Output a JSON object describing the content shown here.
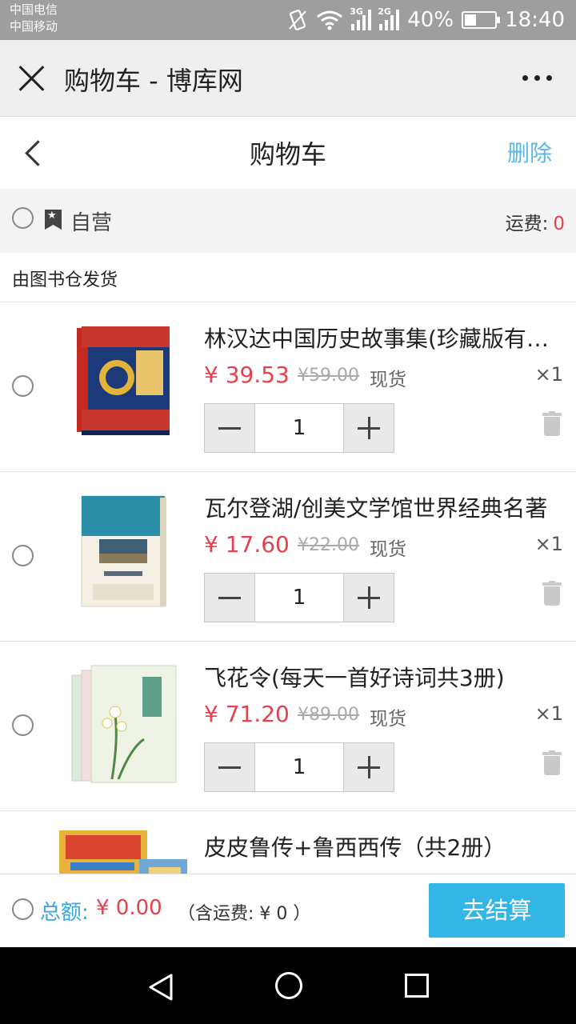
{
  "status_bar": {
    "carrier_1": "中国电信",
    "carrier_2": "中国移动",
    "net_1": "3G",
    "net_2": "2G",
    "battery_pct": "40%",
    "battery_level": 0.4,
    "time": "18:40"
  },
  "webview": {
    "title": "购物车 - 博库网"
  },
  "header": {
    "title": "购物车",
    "delete_label": "删除"
  },
  "shop": {
    "name": "自营",
    "shipping_label": "运费:",
    "shipping_value": "0",
    "warehouse_note": "由图书仓发货"
  },
  "items": [
    {
      "name": "林汉达中国历史故事集(珍藏版有声版)",
      "price": "¥ 39.53",
      "original_price": "¥59.00",
      "stock": "现货",
      "count": "×1",
      "quantity": "1"
    },
    {
      "name": "瓦尔登湖/创美文学馆世界经典名著",
      "price": "¥ 17.60",
      "original_price": "¥22.00",
      "stock": "现货",
      "count": "×1",
      "quantity": "1"
    },
    {
      "name": "飞花令(每天一首好诗词共3册)",
      "price": "¥ 71.20",
      "original_price": "¥89.00",
      "stock": "现货",
      "count": "×1",
      "quantity": "1"
    },
    {
      "name": "皮皮鲁传+鲁西西传（共2册）"
    }
  ],
  "footer": {
    "total_label": "总额:",
    "total_value": "¥ 0.00",
    "shipping_note": "（含运费: ¥ 0 ）",
    "checkout_label": "去结算"
  },
  "colors": {
    "accent": "#33b5e5",
    "price": "#e0424e",
    "link": "#5bb8e3"
  }
}
